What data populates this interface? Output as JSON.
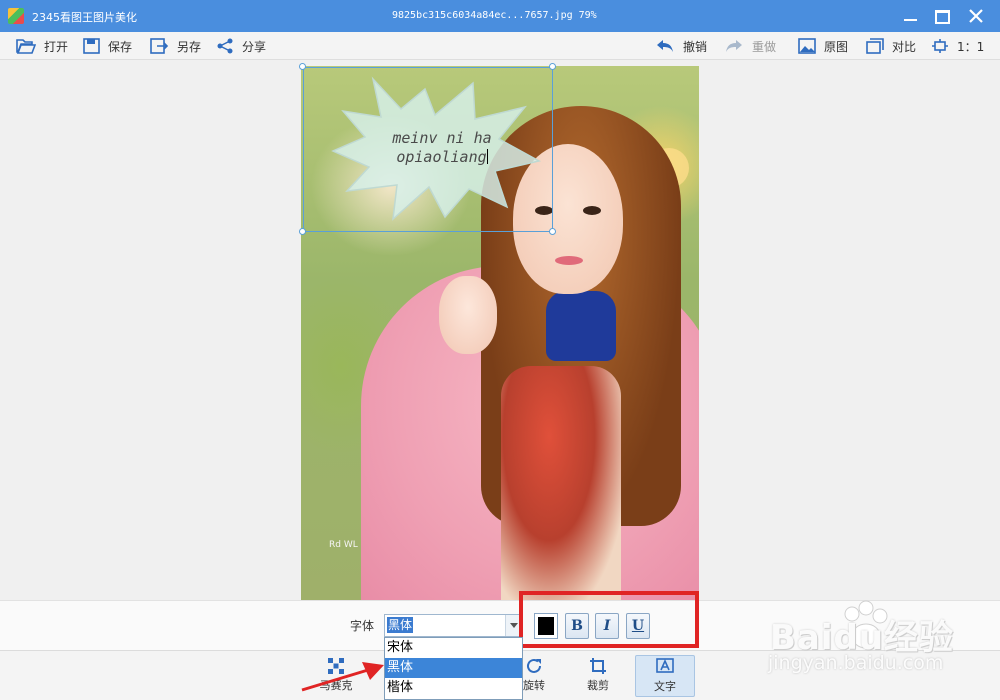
{
  "window": {
    "app_title": "2345看图王图片美化",
    "file_title": "9825bc315c6034a84ec...7657.jpg  79%"
  },
  "toolbar": {
    "open": "打开",
    "save": "保存",
    "save_as": "另存",
    "share": "分享",
    "undo": "撤销",
    "redo": "重做",
    "original": "原图",
    "compare": "对比",
    "actual_size": "1：1"
  },
  "photo": {
    "signature": "Rd WL"
  },
  "sticker": {
    "line1": "meinv ni ha",
    "line2": "opiaoliang"
  },
  "font_settings": {
    "label": "字体",
    "selected_font": "黑体",
    "options": [
      "宋体",
      "黑体",
      "楷体"
    ],
    "selected_index": 1,
    "text_color": "#000000",
    "bold_label": "B",
    "italic_label": "I",
    "underline_label": "U"
  },
  "tools": {
    "mosaic": "马赛克",
    "rotate": "旋转",
    "crop": "裁剪",
    "text": "文字"
  },
  "watermark": {
    "brand": "Baidu经验",
    "url": "jingyan.baidu.com"
  },
  "colors": {
    "titlebar": "#4a8ede",
    "highlight": "#e02424",
    "selected_option": "#3c85d8",
    "icon": "#2f6cbf"
  }
}
